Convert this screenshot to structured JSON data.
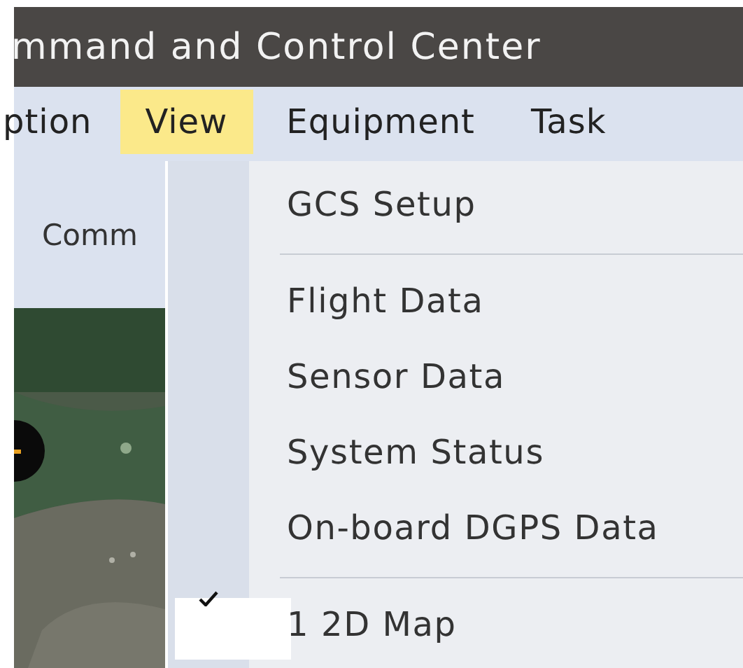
{
  "window": {
    "title": "mmand and Control Center"
  },
  "menu_bar": [
    {
      "label": "ption",
      "selected": false
    },
    {
      "label": "View",
      "selected": true
    },
    {
      "label": "Equipment",
      "selected": false
    },
    {
      "label": "Task",
      "selected": false
    }
  ],
  "toolbar": {
    "label": "Comm"
  },
  "dropdown": [
    {
      "kind": "item",
      "label": "GCS Setup",
      "checked": false
    },
    {
      "kind": "separator"
    },
    {
      "kind": "item",
      "label": "Flight Data",
      "checked": false
    },
    {
      "kind": "item",
      "label": "Sensor Data",
      "checked": false
    },
    {
      "kind": "item",
      "label": "System Status",
      "checked": false
    },
    {
      "kind": "item",
      "label": "On-board DGPS Data",
      "checked": false
    },
    {
      "kind": "separator"
    },
    {
      "kind": "item",
      "label": "1 2D Map",
      "checked": true
    }
  ]
}
